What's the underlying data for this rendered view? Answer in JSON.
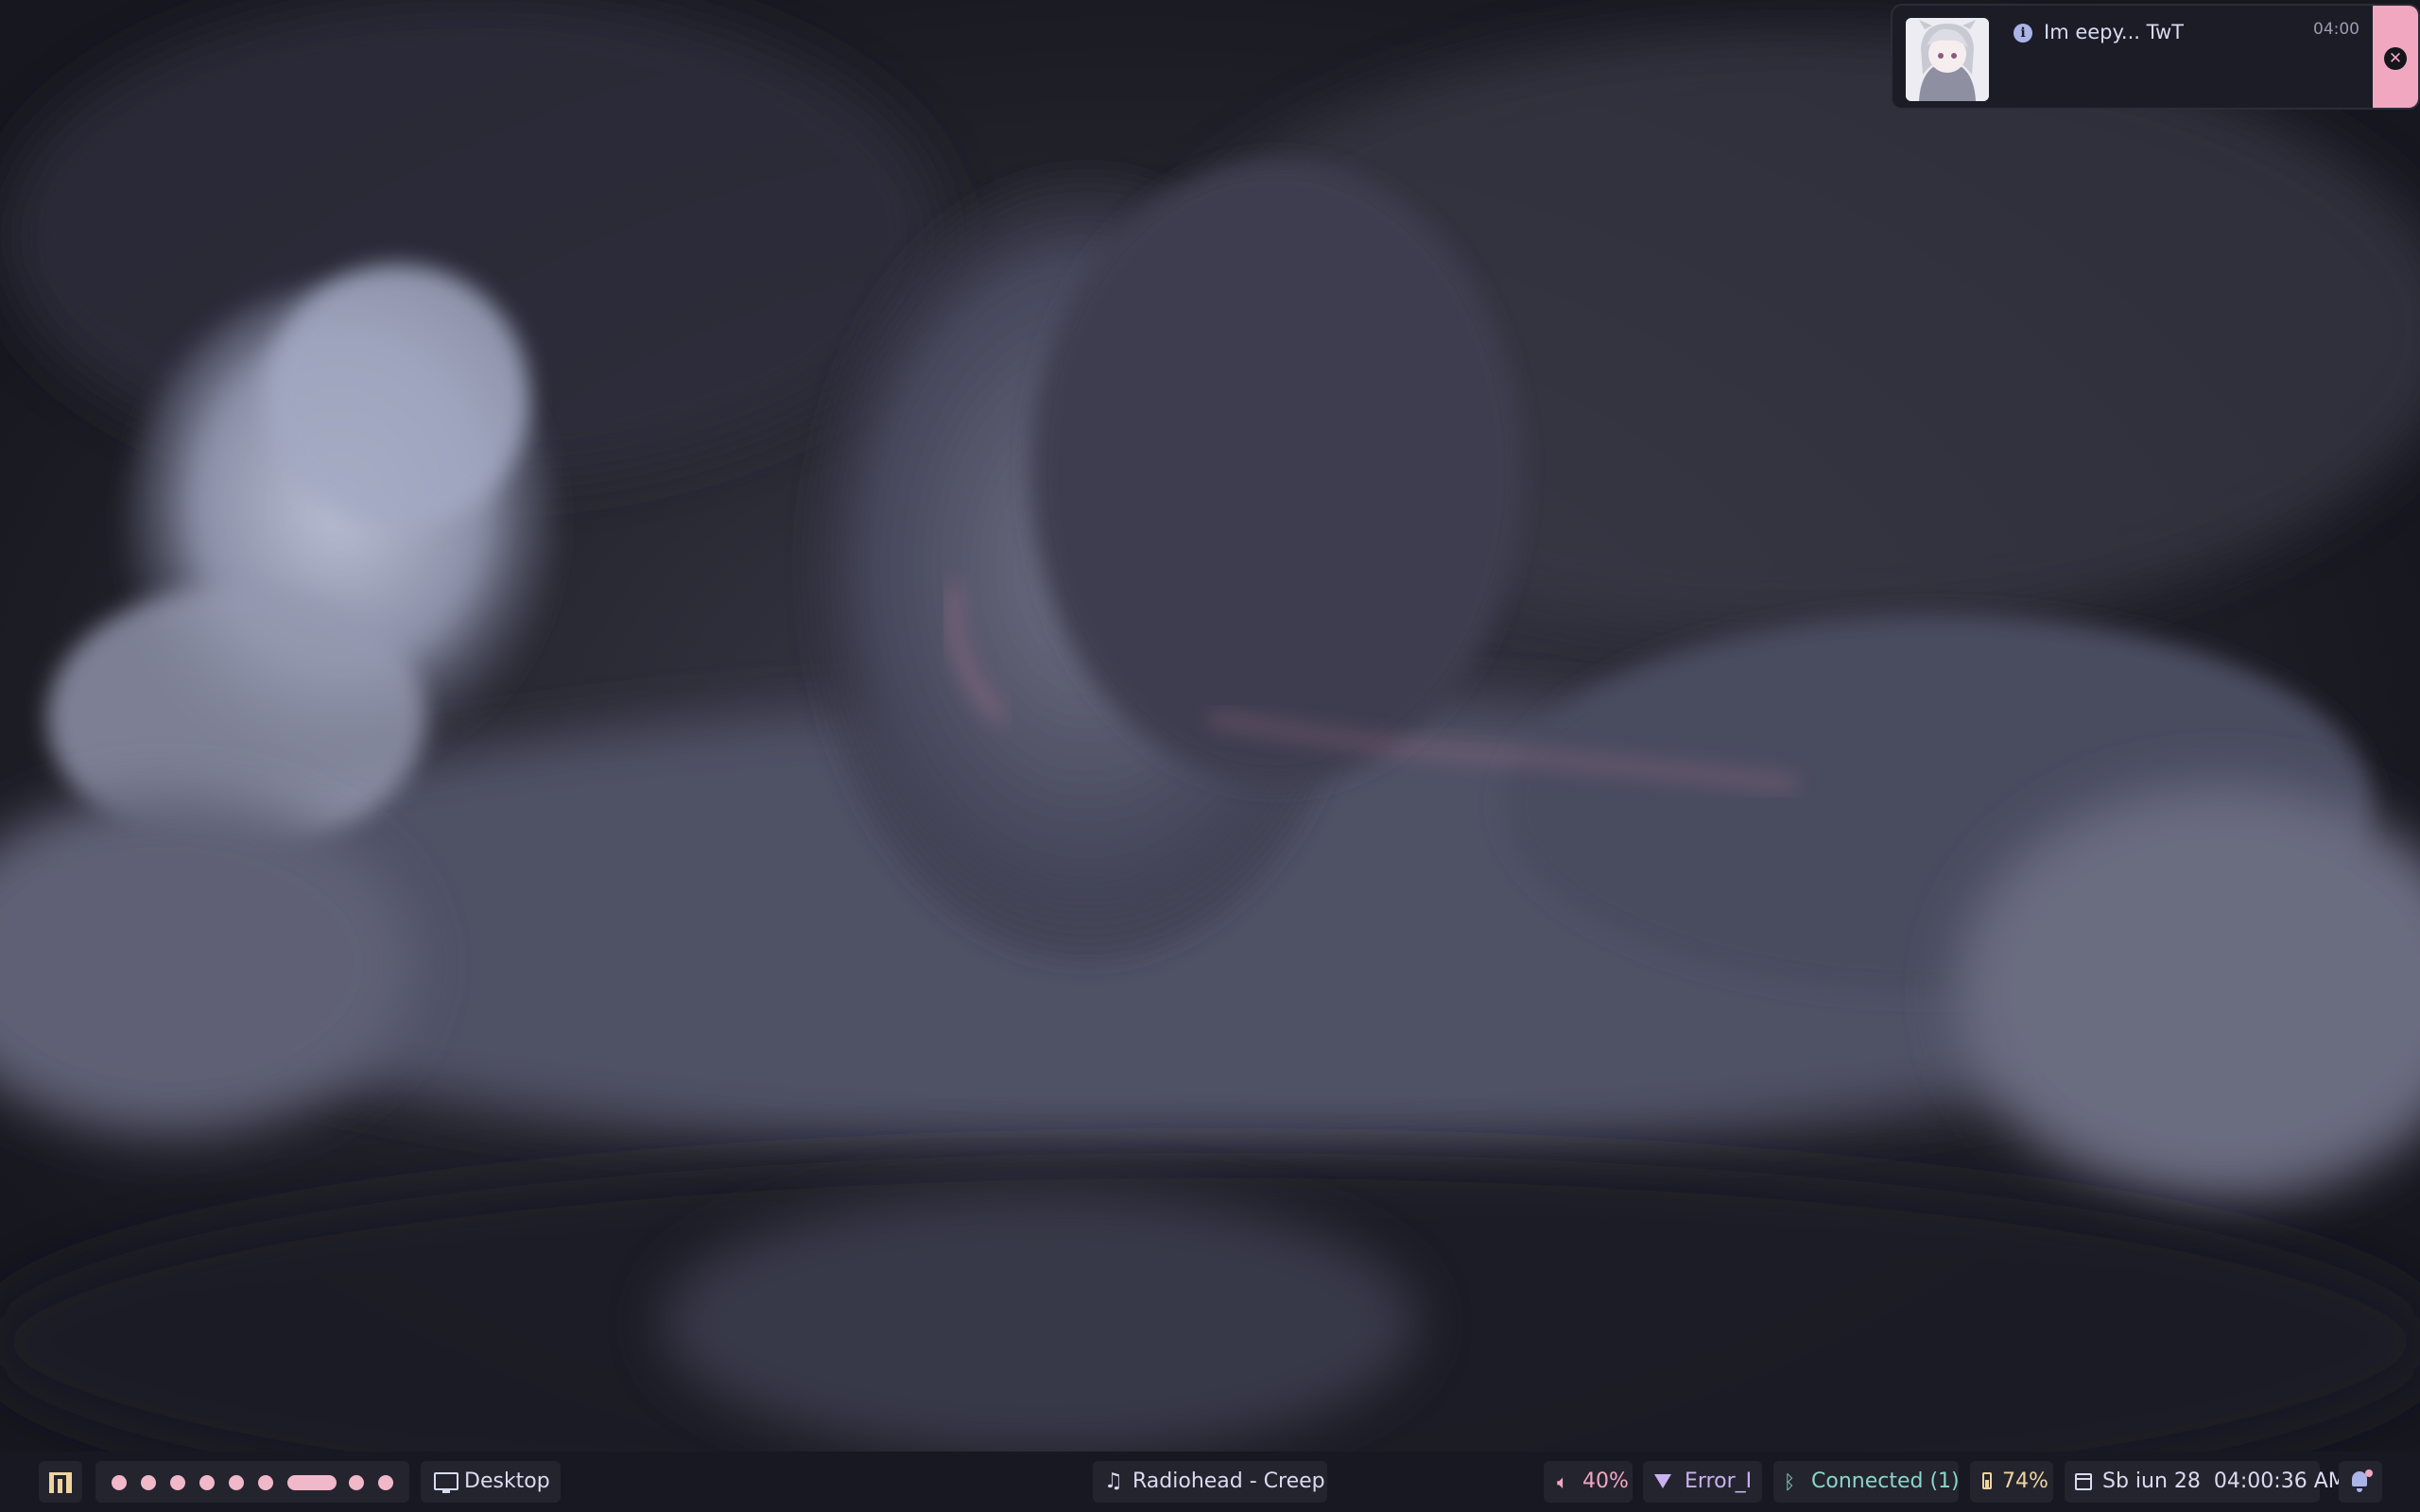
{
  "notification": {
    "title": "Im eepy... TwT",
    "time": "04:00",
    "icon": "info-icon",
    "close_icon": "close-icon"
  },
  "taskbar": {
    "launcher_icon": "app-launcher-icon",
    "workspaces": {
      "count": 9,
      "active_index": 6
    },
    "window_title": "Desktop",
    "media": "Radiohead - Creep",
    "volume": "40%",
    "network": "Error_I",
    "bluetooth": "Connected (1)",
    "battery": "74%",
    "clock": "Sb iun 28  04:00:36 AM",
    "notification_icon": "bell-icon"
  },
  "colors": {
    "accent_pink": "#f2a7c1",
    "bar_bg": "#181822",
    "pill_bg": "#24242f",
    "text": "#d9dcf0",
    "lavender": "#c9b2ef",
    "teal": "#8bd5ca",
    "yellow": "#eed49f"
  }
}
